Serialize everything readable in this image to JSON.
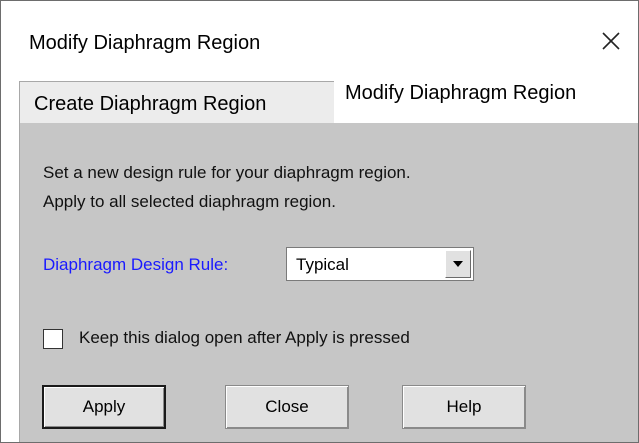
{
  "window": {
    "title": "Modify Diaphragm Region",
    "close_icon": "close-x-icon"
  },
  "tabs": [
    {
      "label": "Create Diaphragm Region",
      "active": false
    },
    {
      "label": "Modify Diaphragm Region",
      "active": true
    }
  ],
  "panel": {
    "instruction_line1": "Set a new design rule for your diaphragm region.",
    "instruction_line2": "Apply to all selected diaphragm region.",
    "design_rule": {
      "label": "Diaphragm Design Rule:",
      "label_color": "#1a1aff",
      "selected_value": "Typical"
    },
    "keep_open": {
      "label": "Keep this dialog open after Apply is pressed",
      "checked": false
    }
  },
  "buttons": {
    "apply": "Apply",
    "close": "Close",
    "help": "Help"
  }
}
